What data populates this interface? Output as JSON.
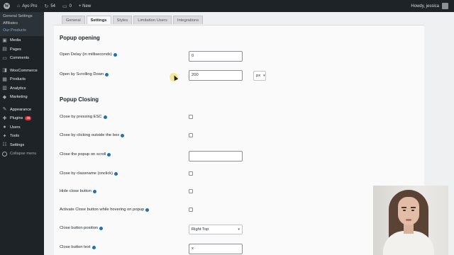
{
  "admin_bar": {
    "site_name": "Ayo Pro",
    "updates_count": "54",
    "comments_count": "0",
    "new_label": "+ New",
    "howdy": "Howdy, jessica"
  },
  "sidebar": {
    "submenu": [
      "General Settings",
      "Affiliates",
      "Our Products"
    ],
    "items": [
      {
        "label": "Media",
        "icon": "media-icon"
      },
      {
        "label": "Pages",
        "icon": "pages-icon"
      },
      {
        "label": "Comments",
        "icon": "comments-icon"
      },
      {
        "label": "WooCommerce",
        "icon": "woocommerce-icon"
      },
      {
        "label": "Products",
        "icon": "products-icon"
      },
      {
        "label": "Analytics",
        "icon": "analytics-icon"
      },
      {
        "label": "Marketing",
        "icon": "marketing-icon"
      },
      {
        "label": "Appearance",
        "icon": "appearance-icon"
      },
      {
        "label": "Plugins",
        "icon": "plugins-icon",
        "badge": "45"
      },
      {
        "label": "Users",
        "icon": "users-icon"
      },
      {
        "label": "Tools",
        "icon": "tools-icon"
      },
      {
        "label": "Settings",
        "icon": "settings-icon"
      }
    ],
    "collapse_label": "Collapse menu"
  },
  "tabs": [
    {
      "label": "General",
      "active": false
    },
    {
      "label": "Settings",
      "active": true
    },
    {
      "label": "Styles",
      "active": false
    },
    {
      "label": "Limitation Users",
      "active": false
    },
    {
      "label": "Integrations",
      "active": false
    }
  ],
  "opening": {
    "title": "Popup opening",
    "delay_label": "Open Delay (in milliseconds)",
    "delay_value": "0",
    "scroll_label": "Open by Scrolling Down",
    "scroll_value": "200",
    "scroll_unit": "px"
  },
  "closing": {
    "title": "Popup Closing",
    "esc_label": "Close by pressing ESC",
    "outside_label": "Close by clicking outside the box",
    "scroll_label": "Close the popup on scroll",
    "scroll_value": "",
    "classname_label": "Close by classname (onclick)",
    "hide_button_label": "Hide close button",
    "hover_label": "Activate Close button while hovering on popup",
    "position_label": "Close button position",
    "position_value": "Right Top",
    "text_label": "Close button text",
    "text_value": "x"
  },
  "colors": {
    "admin_bar": "#1d2327",
    "sidebar": "#1d2327",
    "accent": "#2271b1",
    "current_submenu": "#72aee6",
    "badge": "#d63638"
  }
}
